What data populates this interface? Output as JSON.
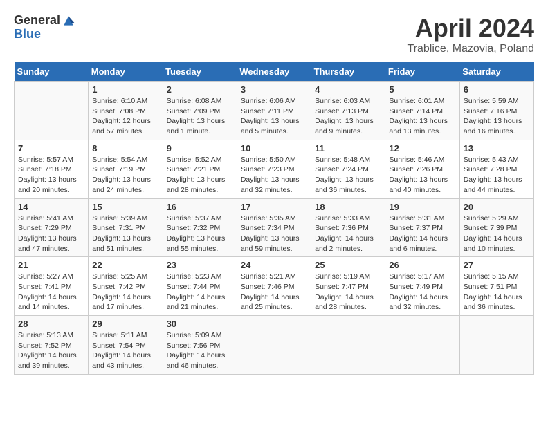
{
  "logo": {
    "general": "General",
    "blue": "Blue"
  },
  "title": "April 2024",
  "subtitle": "Trablice, Mazovia, Poland",
  "days_of_week": [
    "Sunday",
    "Monday",
    "Tuesday",
    "Wednesday",
    "Thursday",
    "Friday",
    "Saturday"
  ],
  "weeks": [
    [
      {
        "num": "",
        "info": ""
      },
      {
        "num": "1",
        "info": "Sunrise: 6:10 AM\nSunset: 7:08 PM\nDaylight: 12 hours\nand 57 minutes."
      },
      {
        "num": "2",
        "info": "Sunrise: 6:08 AM\nSunset: 7:09 PM\nDaylight: 13 hours\nand 1 minute."
      },
      {
        "num": "3",
        "info": "Sunrise: 6:06 AM\nSunset: 7:11 PM\nDaylight: 13 hours\nand 5 minutes."
      },
      {
        "num": "4",
        "info": "Sunrise: 6:03 AM\nSunset: 7:13 PM\nDaylight: 13 hours\nand 9 minutes."
      },
      {
        "num": "5",
        "info": "Sunrise: 6:01 AM\nSunset: 7:14 PM\nDaylight: 13 hours\nand 13 minutes."
      },
      {
        "num": "6",
        "info": "Sunrise: 5:59 AM\nSunset: 7:16 PM\nDaylight: 13 hours\nand 16 minutes."
      }
    ],
    [
      {
        "num": "7",
        "info": "Sunrise: 5:57 AM\nSunset: 7:18 PM\nDaylight: 13 hours\nand 20 minutes."
      },
      {
        "num": "8",
        "info": "Sunrise: 5:54 AM\nSunset: 7:19 PM\nDaylight: 13 hours\nand 24 minutes."
      },
      {
        "num": "9",
        "info": "Sunrise: 5:52 AM\nSunset: 7:21 PM\nDaylight: 13 hours\nand 28 minutes."
      },
      {
        "num": "10",
        "info": "Sunrise: 5:50 AM\nSunset: 7:23 PM\nDaylight: 13 hours\nand 32 minutes."
      },
      {
        "num": "11",
        "info": "Sunrise: 5:48 AM\nSunset: 7:24 PM\nDaylight: 13 hours\nand 36 minutes."
      },
      {
        "num": "12",
        "info": "Sunrise: 5:46 AM\nSunset: 7:26 PM\nDaylight: 13 hours\nand 40 minutes."
      },
      {
        "num": "13",
        "info": "Sunrise: 5:43 AM\nSunset: 7:28 PM\nDaylight: 13 hours\nand 44 minutes."
      }
    ],
    [
      {
        "num": "14",
        "info": "Sunrise: 5:41 AM\nSunset: 7:29 PM\nDaylight: 13 hours\nand 47 minutes."
      },
      {
        "num": "15",
        "info": "Sunrise: 5:39 AM\nSunset: 7:31 PM\nDaylight: 13 hours\nand 51 minutes."
      },
      {
        "num": "16",
        "info": "Sunrise: 5:37 AM\nSunset: 7:32 PM\nDaylight: 13 hours\nand 55 minutes."
      },
      {
        "num": "17",
        "info": "Sunrise: 5:35 AM\nSunset: 7:34 PM\nDaylight: 13 hours\nand 59 minutes."
      },
      {
        "num": "18",
        "info": "Sunrise: 5:33 AM\nSunset: 7:36 PM\nDaylight: 14 hours\nand 2 minutes."
      },
      {
        "num": "19",
        "info": "Sunrise: 5:31 AM\nSunset: 7:37 PM\nDaylight: 14 hours\nand 6 minutes."
      },
      {
        "num": "20",
        "info": "Sunrise: 5:29 AM\nSunset: 7:39 PM\nDaylight: 14 hours\nand 10 minutes."
      }
    ],
    [
      {
        "num": "21",
        "info": "Sunrise: 5:27 AM\nSunset: 7:41 PM\nDaylight: 14 hours\nand 14 minutes."
      },
      {
        "num": "22",
        "info": "Sunrise: 5:25 AM\nSunset: 7:42 PM\nDaylight: 14 hours\nand 17 minutes."
      },
      {
        "num": "23",
        "info": "Sunrise: 5:23 AM\nSunset: 7:44 PM\nDaylight: 14 hours\nand 21 minutes."
      },
      {
        "num": "24",
        "info": "Sunrise: 5:21 AM\nSunset: 7:46 PM\nDaylight: 14 hours\nand 25 minutes."
      },
      {
        "num": "25",
        "info": "Sunrise: 5:19 AM\nSunset: 7:47 PM\nDaylight: 14 hours\nand 28 minutes."
      },
      {
        "num": "26",
        "info": "Sunrise: 5:17 AM\nSunset: 7:49 PM\nDaylight: 14 hours\nand 32 minutes."
      },
      {
        "num": "27",
        "info": "Sunrise: 5:15 AM\nSunset: 7:51 PM\nDaylight: 14 hours\nand 36 minutes."
      }
    ],
    [
      {
        "num": "28",
        "info": "Sunrise: 5:13 AM\nSunset: 7:52 PM\nDaylight: 14 hours\nand 39 minutes."
      },
      {
        "num": "29",
        "info": "Sunrise: 5:11 AM\nSunset: 7:54 PM\nDaylight: 14 hours\nand 43 minutes."
      },
      {
        "num": "30",
        "info": "Sunrise: 5:09 AM\nSunset: 7:56 PM\nDaylight: 14 hours\nand 46 minutes."
      },
      {
        "num": "",
        "info": ""
      },
      {
        "num": "",
        "info": ""
      },
      {
        "num": "",
        "info": ""
      },
      {
        "num": "",
        "info": ""
      }
    ]
  ]
}
